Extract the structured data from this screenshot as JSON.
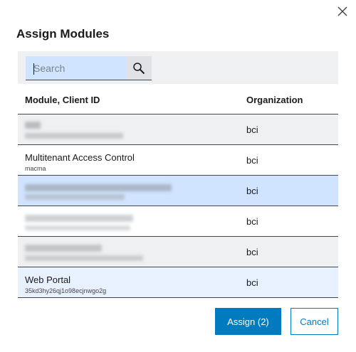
{
  "dialog": {
    "title": "Assign Modules",
    "close_icon": "close-icon"
  },
  "search": {
    "placeholder": "Search",
    "value": "",
    "icon": "search-icon"
  },
  "table": {
    "columns": [
      "Module, Client ID",
      "Organization"
    ],
    "rows": [
      {
        "name": "",
        "client_id": "",
        "organization": "bci",
        "redacted": true,
        "state": "gray"
      },
      {
        "name": "Multitenant Access Control",
        "client_id": "macma",
        "organization": "bci",
        "redacted": false,
        "state": "white"
      },
      {
        "name": "",
        "client_id": "",
        "organization": "bci",
        "redacted": true,
        "state": "selected"
      },
      {
        "name": "",
        "client_id": "",
        "organization": "bci",
        "redacted": true,
        "state": "white"
      },
      {
        "name": "",
        "client_id": "",
        "organization": "bci",
        "redacted": true,
        "state": "gray"
      },
      {
        "name": "Web Portal",
        "client_id": "35kd3hy26qj1o98ecjnwgo2g",
        "organization": "bci",
        "redacted": false,
        "state": "selected-light"
      }
    ]
  },
  "actions": {
    "assign_label": "Assign (2)",
    "cancel_label": "Cancel"
  },
  "colors": {
    "primary": "#007bc0",
    "selected_row": "#d1e4ff",
    "toolbar_bg": "#eff0f1"
  }
}
